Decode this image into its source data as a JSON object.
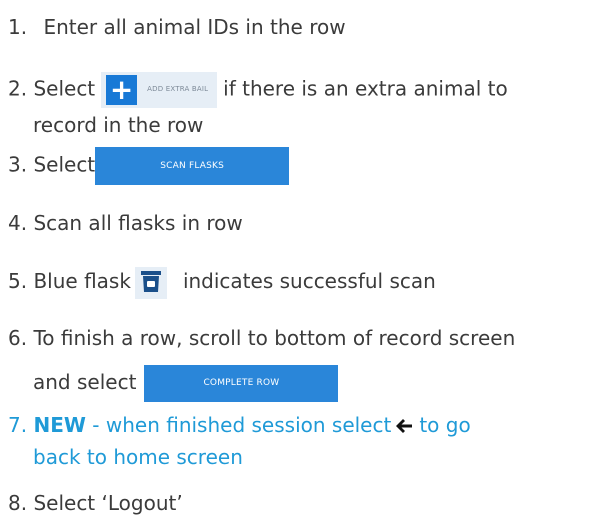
{
  "steps": [
    {
      "num": "1.",
      "text": "Enter all animal IDs in the row"
    },
    {
      "num": "2.",
      "before": "Select",
      "button": "ADD EXTRA BAIL",
      "after": "if there is an extra animal to",
      "cont": "record in the row"
    },
    {
      "num": "3.",
      "before": "Select",
      "button": "SCAN FLASKS"
    },
    {
      "num": "4.",
      "text": "Scan all flasks in row"
    },
    {
      "num": "5.",
      "before": "Blue flask",
      "icon": "blue-flask-icon",
      "after": "indicates successful scan"
    },
    {
      "num": "6.",
      "text": "To finish a row, scroll to bottom of record screen",
      "cont_before": "and select",
      "button": "COMPLETE ROW"
    },
    {
      "num": "7.",
      "bold": "NEW",
      "before": "- when finished session select",
      "icon": "back-arrow-icon",
      "after": "to go",
      "cont": "back to home screen"
    },
    {
      "num": "8.",
      "text": "Select ‘Logout’"
    }
  ],
  "colors": {
    "text": "#3b3b3b",
    "highlight": "#1f9ad7",
    "button": "#2a86d9",
    "button_light": "#e6eef6",
    "plus_box": "#1879d6"
  }
}
